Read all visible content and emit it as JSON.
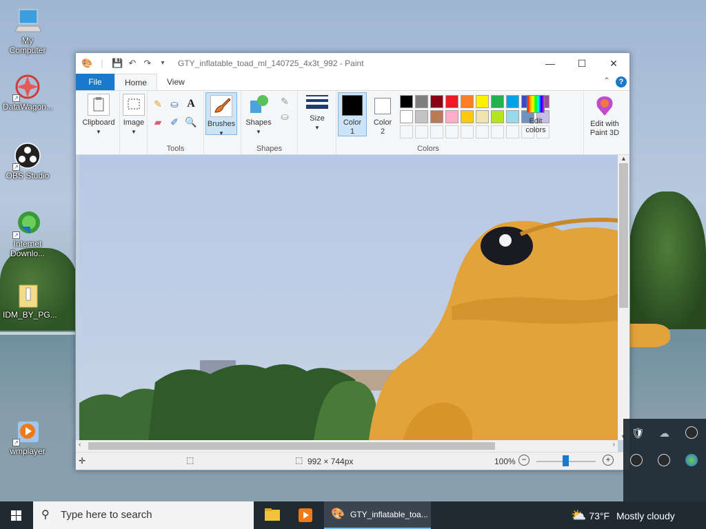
{
  "desktop": {
    "icons": [
      {
        "label": "My Computer",
        "icon": "computer-icon"
      },
      {
        "label": "DataWagon...",
        "icon": "datawagon-icon"
      },
      {
        "label": "OBS Studio",
        "icon": "obs-icon"
      },
      {
        "label": "Internet Downlo...",
        "icon": "idm-icon"
      },
      {
        "label": "IDM_BY_PG...",
        "icon": "folder-zip-icon"
      },
      {
        "label": "wmplayer",
        "icon": "media-player-icon"
      }
    ]
  },
  "window": {
    "title": "GTY_inflatable_toad_ml_140725_4x3t_992 - Paint",
    "tabs": [
      "File",
      "Home",
      "View"
    ],
    "ribbon": {
      "clipboard": "Clipboard",
      "image": "Image",
      "tools_group": "Tools",
      "brushes": "Brushes",
      "shapes": "Shapes",
      "shapes_group": "Shapes",
      "size": "Size",
      "color1": "Color 1",
      "color2": "Color 2",
      "colors_group": "Colors",
      "edit_colors": "Edit colors",
      "edit_paint3d": "Edit with Paint 3D"
    },
    "palette_row1": [
      "#000000",
      "#7f7f7f",
      "#880015",
      "#ed1c24",
      "#ff7f27",
      "#fff200",
      "#22b14c",
      "#00a2e8",
      "#3f48cc",
      "#a349a4"
    ],
    "palette_row2": [
      "#ffffff",
      "#c3c3c3",
      "#b97a57",
      "#ffaec9",
      "#ffc90e",
      "#efe4b0",
      "#b5e61d",
      "#99d9ea",
      "#7092be",
      "#c8bfe7"
    ],
    "status": {
      "dimensions": "992 × 744px",
      "zoom": "100%"
    }
  },
  "taskbar": {
    "search_placeholder": "Type here to search",
    "active_app": "GTY_inflatable_toa...",
    "weather_temp": "73°F",
    "weather_desc": "Mostly cloudy"
  }
}
